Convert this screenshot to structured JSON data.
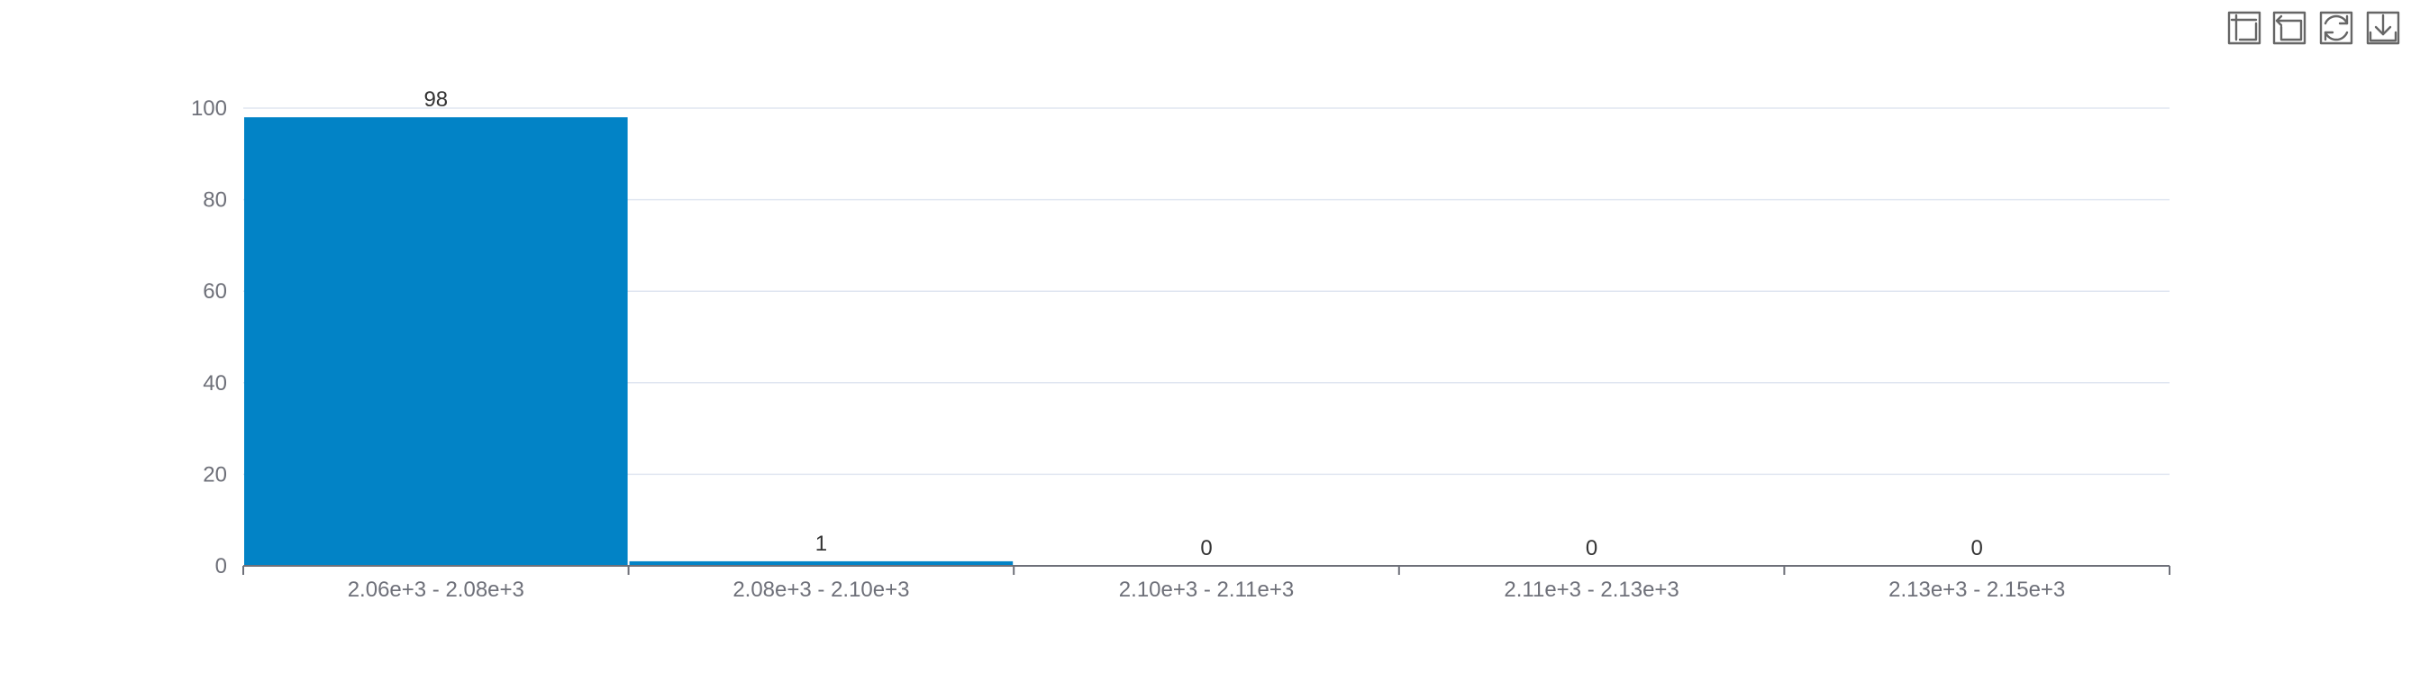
{
  "toolbox": {
    "items": [
      {
        "name": "zoom-icon",
        "tooltip": ""
      },
      {
        "name": "zoom-back-icon",
        "tooltip": ""
      },
      {
        "name": "restore-icon",
        "tooltip": ""
      },
      {
        "name": "download-icon",
        "tooltip": ""
      }
    ],
    "icon_color": "#666666"
  },
  "chart_data": {
    "type": "bar",
    "categories": [
      "2.06e+3 - 2.08e+3",
      "2.08e+3 - 2.10e+3",
      "2.10e+3 - 2.11e+3",
      "2.11e+3 - 2.13e+3",
      "2.13e+3 - 2.15e+3"
    ],
    "series": [
      {
        "values": [
          98,
          1,
          0,
          0,
          0
        ],
        "color": "#0283c6"
      }
    ],
    "title": "",
    "xlabel": "",
    "ylabel": "",
    "ylim": [
      0,
      100
    ],
    "yticks": [
      0,
      20,
      40,
      60,
      80,
      100
    ],
    "grid": true,
    "grid_color": "#e0e6f1",
    "axis_color": "#6e7079",
    "show_data_labels": true
  }
}
